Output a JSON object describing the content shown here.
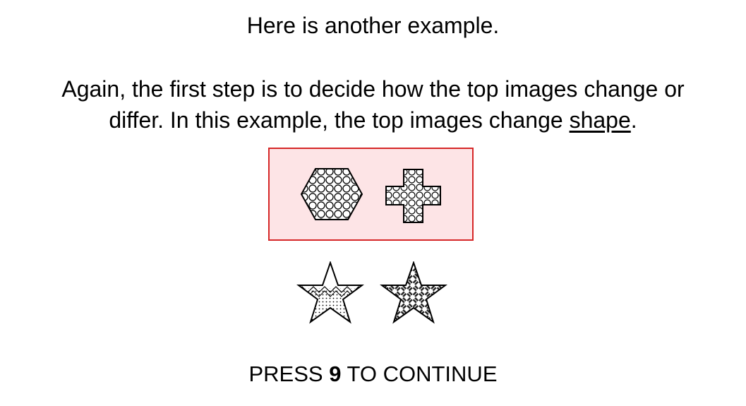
{
  "slide": {
    "heading": "Here is another example.",
    "line2": "Again, the first step is to decide how the top images change or",
    "line3_before": "differ. In this example, the top images change ",
    "line3_keyword": "shape",
    "line3_after": "."
  },
  "figures": {
    "top_row": [
      "hexagon-icon",
      "plus-icon"
    ],
    "bottom_row": [
      "star-icon",
      "star-icon"
    ],
    "highlight_color": "#d62728",
    "highlight_fill": "#fde4e6"
  },
  "footer": {
    "press_prefix": "PRESS ",
    "press_key": "9",
    "press_suffix": " TO CONTINUE"
  }
}
